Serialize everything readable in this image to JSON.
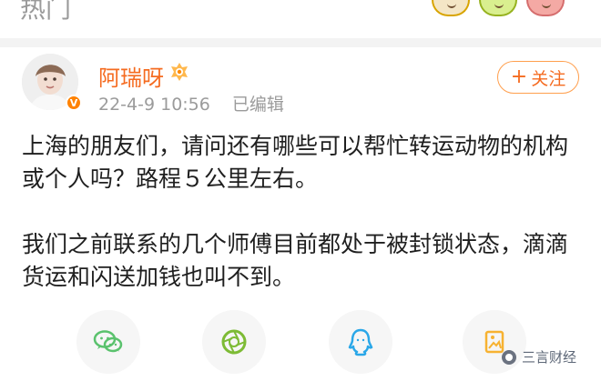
{
  "header": {
    "tab_label": "热门",
    "emoji_icons": [
      "smile-emoji-icon",
      "green-emoji-icon",
      "pink-emoji-icon"
    ]
  },
  "post": {
    "author": {
      "name": "阿瑞呀",
      "verified_badge": "V",
      "badge_icon": "fan-badge-icon"
    },
    "meta": {
      "timestamp": "22-4-9 10:56",
      "edited_label": "已编辑"
    },
    "follow_button": {
      "plus": "+",
      "label": "关注"
    },
    "content": {
      "paragraph_1": "上海的朋友们，请问还有哪些可以帮忙转运动物的机构或个人吗？路程５公里左右。",
      "paragraph_2": "我们之前联系的几个师傅目前都处于被封锁状态，滴滴货运和闪送加钱也叫不到。"
    }
  },
  "share": {
    "items": [
      {
        "name": "wechat-icon",
        "color": "#5ac26d"
      },
      {
        "name": "moments-icon",
        "color": "#7dbb35"
      },
      {
        "name": "qq-icon",
        "color": "#2aa7e8"
      },
      {
        "name": "image-icon",
        "color": "#f7b231"
      }
    ]
  },
  "watermark": {
    "text": "三言财经"
  },
  "colors": {
    "accent": "#f56b20",
    "follow_border": "#ff9f4d",
    "meta_gray": "#9b9b9b"
  }
}
